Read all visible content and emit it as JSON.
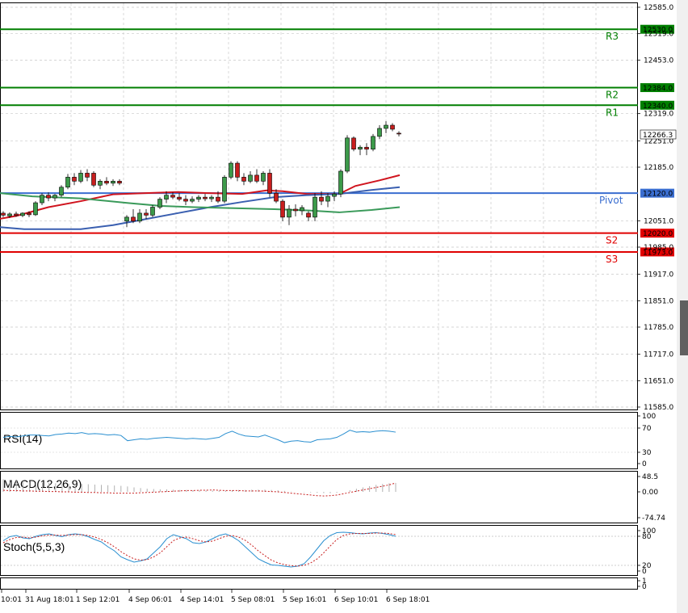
{
  "colors": {
    "resistance": "#007f00",
    "support": "#e00000",
    "pivot": "#3a6ed0",
    "ma_red": "#d0141e",
    "ma_blue": "#3a5fb0",
    "ma_green": "#3a9a5a",
    "candle_up": "#3c9a4a",
    "candle_down": "#c81e1e",
    "rsi": "#2a8fd0",
    "grid": "#c8c8c8"
  },
  "price_axis": {
    "ticks": [
      "12585.0",
      "12519.0",
      "12453.0",
      "12319.0",
      "12251.0",
      "12185.0",
      "12051.0",
      "11985.0",
      "11917.0",
      "11851.0",
      "11785.0",
      "11717.0",
      "11651.0",
      "11585.0"
    ],
    "current_price": "12266.3"
  },
  "levels": [
    {
      "name": "R3",
      "value": "12530.0",
      "type": "resistance"
    },
    {
      "name": "R2",
      "value": "12384.0",
      "type": "resistance"
    },
    {
      "name": "R1",
      "value": "12340.0",
      "type": "resistance"
    },
    {
      "name": "Pivot",
      "value": "12120.0",
      "type": "pivot"
    },
    {
      "name": "S2",
      "value": "12020.0",
      "type": "support"
    },
    {
      "name": "S3",
      "value": "11973.0",
      "type": "support"
    }
  ],
  "indicators": {
    "rsi": {
      "label": "RSI(14)",
      "ticks": [
        "100",
        "70",
        "30",
        "0"
      ]
    },
    "macd": {
      "label": "MACD(12,26,9)",
      "ticks": [
        "48.5",
        "0.00",
        "-74.74"
      ]
    },
    "stoch": {
      "label": "Stoch(5,5,3)",
      "ticks": [
        "100",
        "80",
        "20",
        "0"
      ]
    }
  },
  "extra_axis": {
    "ticks": [
      "1",
      "0"
    ]
  },
  "time_axis": [
    "10:01",
    "31 Aug 18:01",
    "1 Sep 12:01",
    "4 Sep 06:01",
    "4 Sep 14:01",
    "5 Sep 08:01",
    "5 Sep 16:01",
    "6 Sep 10:01",
    "6 Sep 18:01"
  ]
}
